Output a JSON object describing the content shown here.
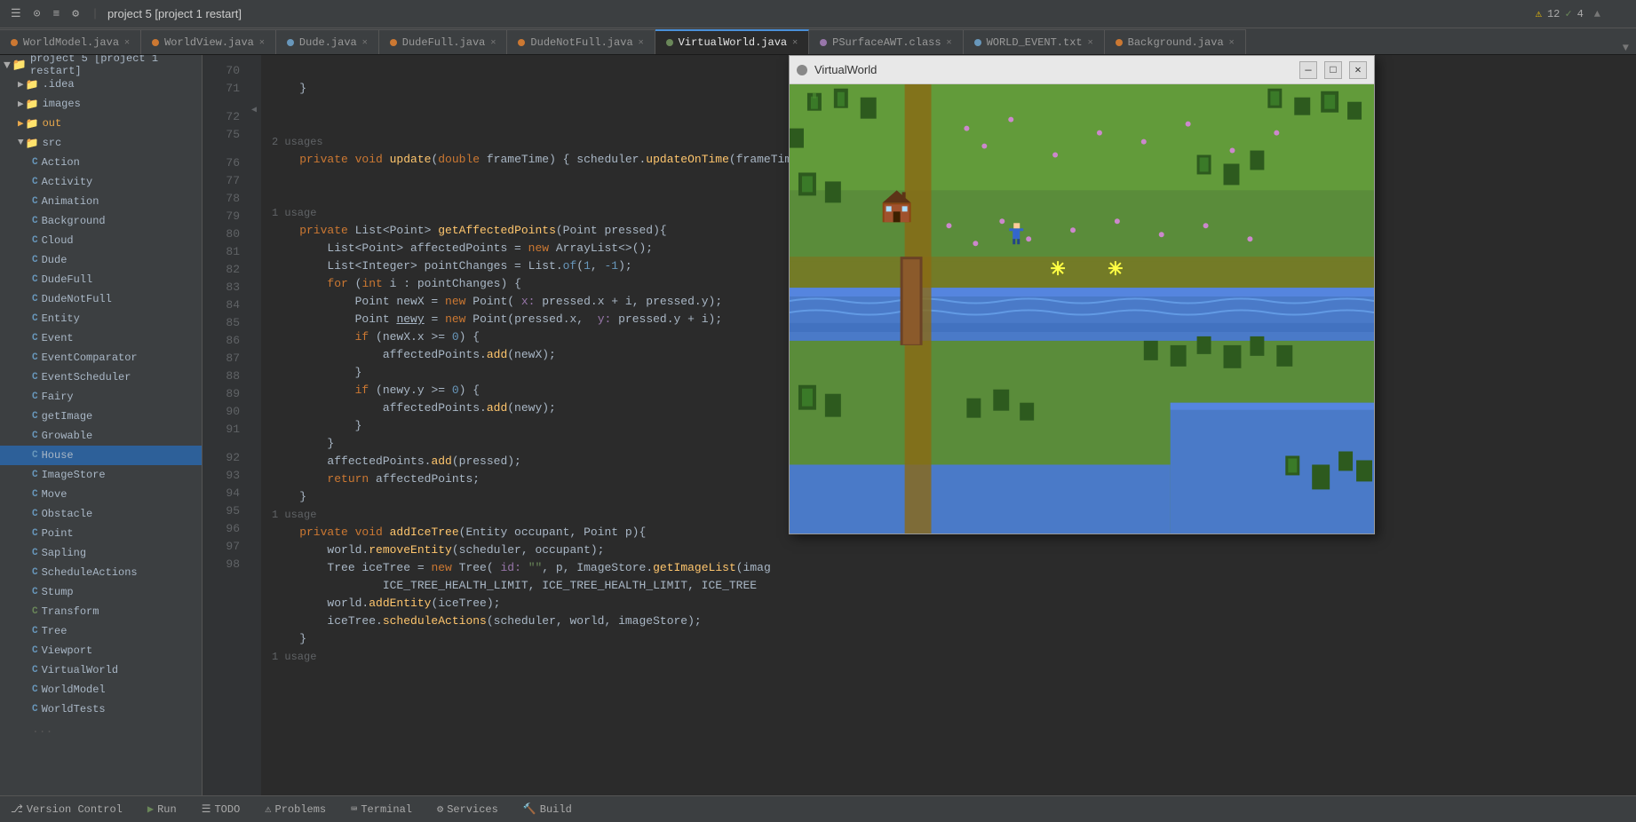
{
  "topbar": {
    "project_label": "project 5 [project 1 restart]",
    "icons": [
      "☰",
      "⊙",
      "≡",
      "⚙",
      "—",
      "□"
    ]
  },
  "tabs": [
    {
      "label": "WorldModel.java",
      "dot": "orange",
      "active": false,
      "closeable": true
    },
    {
      "label": "WorldView.java",
      "dot": "orange",
      "active": false,
      "closeable": true
    },
    {
      "label": "Dude.java",
      "dot": "blue",
      "active": false,
      "closeable": true
    },
    {
      "label": "DudeFull.java",
      "dot": "orange",
      "active": false,
      "closeable": true
    },
    {
      "label": "DudeNotFull.java",
      "dot": "orange",
      "active": false,
      "closeable": true
    },
    {
      "label": "VirtualWorld.java",
      "dot": "green",
      "active": true,
      "closeable": true
    },
    {
      "label": "PSurfaceAWT.class",
      "dot": "purple",
      "active": false,
      "closeable": true
    },
    {
      "label": "WORLD_EVENT.txt",
      "dot": "blue",
      "active": false,
      "closeable": true
    },
    {
      "label": "Background.java",
      "dot": "orange",
      "active": false,
      "closeable": true
    }
  ],
  "warnings": {
    "warn_count": "12",
    "check_count": "4"
  },
  "sidebar": {
    "project_root": "project 5 [project 1 restart]",
    "items": [
      {
        "name": ".idea",
        "type": "folder",
        "indent": 1,
        "expanded": false
      },
      {
        "name": "images",
        "type": "folder",
        "indent": 1,
        "expanded": false
      },
      {
        "name": "out",
        "type": "folder",
        "indent": 1,
        "expanded": false,
        "color": "orange"
      },
      {
        "name": "src",
        "type": "folder",
        "indent": 1,
        "expanded": true
      },
      {
        "name": "Action",
        "type": "class",
        "indent": 2,
        "color": "blue"
      },
      {
        "name": "Activity",
        "type": "class",
        "indent": 2,
        "color": "blue"
      },
      {
        "name": "Animation",
        "type": "class",
        "indent": 2,
        "color": "blue"
      },
      {
        "name": "Background",
        "type": "class",
        "indent": 2,
        "color": "blue"
      },
      {
        "name": "Cloud",
        "type": "class",
        "indent": 2,
        "color": "blue"
      },
      {
        "name": "Dude",
        "type": "class",
        "indent": 2,
        "color": "blue"
      },
      {
        "name": "DudeFull",
        "type": "class",
        "indent": 2,
        "color": "blue"
      },
      {
        "name": "DudeNotFull",
        "type": "class",
        "indent": 2,
        "color": "blue"
      },
      {
        "name": "Entity",
        "type": "class",
        "indent": 2,
        "color": "blue"
      },
      {
        "name": "Event",
        "type": "class",
        "indent": 2,
        "color": "blue"
      },
      {
        "name": "EventComparator",
        "type": "class",
        "indent": 2,
        "color": "blue"
      },
      {
        "name": "EventScheduler",
        "type": "class",
        "indent": 2,
        "color": "blue"
      },
      {
        "name": "Fairy",
        "type": "class",
        "indent": 2,
        "color": "blue"
      },
      {
        "name": "getImage",
        "type": "class",
        "indent": 2,
        "color": "blue"
      },
      {
        "name": "Growable",
        "type": "class",
        "indent": 2,
        "color": "blue"
      },
      {
        "name": "House",
        "type": "class",
        "indent": 2,
        "color": "blue",
        "selected": true
      },
      {
        "name": "ImageStore",
        "type": "class",
        "indent": 2,
        "color": "blue"
      },
      {
        "name": "Move",
        "type": "class",
        "indent": 2,
        "color": "blue"
      },
      {
        "name": "Obstacle",
        "type": "class",
        "indent": 2,
        "color": "blue"
      },
      {
        "name": "Point",
        "type": "class",
        "indent": 2,
        "color": "blue"
      },
      {
        "name": "Sapling",
        "type": "class",
        "indent": 2,
        "color": "blue"
      },
      {
        "name": "ScheduleActions",
        "type": "class",
        "indent": 2,
        "color": "blue"
      },
      {
        "name": "Stump",
        "type": "class",
        "indent": 2,
        "color": "blue"
      },
      {
        "name": "Transform",
        "type": "class",
        "indent": 2,
        "color": "blue"
      },
      {
        "name": "Tree",
        "type": "class",
        "indent": 2,
        "color": "blue"
      },
      {
        "name": "Viewport",
        "type": "class",
        "indent": 2,
        "color": "blue"
      },
      {
        "name": "VirtualWorld",
        "type": "class",
        "indent": 2,
        "color": "blue"
      },
      {
        "name": "WorldModel",
        "type": "class",
        "indent": 2,
        "color": "blue"
      },
      {
        "name": "WorldTests",
        "type": "class",
        "indent": 2,
        "color": "blue"
      }
    ]
  },
  "editor": {
    "lines": [
      {
        "num": "70",
        "content": "    }",
        "type": "plain"
      },
      {
        "num": "71",
        "content": "",
        "type": "plain"
      },
      {
        "num": "",
        "content": "2 usages",
        "type": "hint"
      },
      {
        "num": "72",
        "content": "    private void update(double frameTime) { scheduler.updateOnTime(frameTime); }",
        "type": "code"
      },
      {
        "num": "75",
        "content": "",
        "type": "plain"
      },
      {
        "num": "",
        "content": "1 usage",
        "type": "hint"
      },
      {
        "num": "76",
        "content": "    private List<Point> getAffectedPoints(Point pressed){",
        "type": "code"
      },
      {
        "num": "77",
        "content": "        List<Point> affectedPoints = new ArrayList<>();",
        "type": "code"
      },
      {
        "num": "78",
        "content": "        List<Integer> pointChanges = List.of(1, -1);",
        "type": "code"
      },
      {
        "num": "79",
        "content": "        for (int i : pointChanges) {",
        "type": "code"
      },
      {
        "num": "80",
        "content": "            Point newX = new Point( x: pressed.x + i, pressed.y);",
        "type": "code"
      },
      {
        "num": "81",
        "content": "            Point newy = new Point(pressed.x,  y: pressed.y + i);",
        "type": "code"
      },
      {
        "num": "82",
        "content": "            if (newX.x >= 0) {",
        "type": "code"
      },
      {
        "num": "83",
        "content": "                affectedPoints.add(newX);",
        "type": "code"
      },
      {
        "num": "84",
        "content": "            }",
        "type": "code"
      },
      {
        "num": "85",
        "content": "            if (newy.y >= 0) {",
        "type": "code"
      },
      {
        "num": "86",
        "content": "                affectedPoints.add(newy);",
        "type": "code"
      },
      {
        "num": "87",
        "content": "            }",
        "type": "code"
      },
      {
        "num": "88",
        "content": "        }",
        "type": "code"
      },
      {
        "num": "89",
        "content": "        affectedPoints.add(pressed);",
        "type": "code"
      },
      {
        "num": "90",
        "content": "        return affectedPoints;",
        "type": "code"
      },
      {
        "num": "91",
        "content": "    }",
        "type": "code"
      },
      {
        "num": "",
        "content": "1 usage",
        "type": "hint"
      },
      {
        "num": "92",
        "content": "    private void addIceTree(Entity occupant, Point p){",
        "type": "code"
      },
      {
        "num": "93",
        "content": "        world.removeEntity(scheduler, occupant);",
        "type": "code"
      },
      {
        "num": "94",
        "content": "        Tree iceTree = new Tree( id: \"\", p, ImageStore.getImageList(imag",
        "type": "code"
      },
      {
        "num": "95",
        "content": "                ICE_TREE_HEALTH_LIMIT, ICE_TREE_HEALTH_LIMIT, ICE_TREE",
        "type": "code"
      },
      {
        "num": "96",
        "content": "        world.addEntity(iceTree);",
        "type": "code"
      },
      {
        "num": "97",
        "content": "        iceTree.scheduleActions(scheduler, world, imageStore);",
        "type": "code"
      },
      {
        "num": "98",
        "content": "    }",
        "type": "code"
      },
      {
        "num": "",
        "content": "1 usage",
        "type": "hint"
      }
    ]
  },
  "virtualworld": {
    "title": "VirtualWorld",
    "close_btn": "✕",
    "minimize_btn": "—",
    "maximize_btn": "□"
  },
  "bottombar": {
    "items": [
      {
        "label": "Version Control",
        "icon": "⎇"
      },
      {
        "label": "▶ Run",
        "icon": ""
      },
      {
        "label": "☰ TODO",
        "icon": ""
      },
      {
        "label": "⚠ Problems",
        "icon": ""
      },
      {
        "label": "Terminal",
        "icon": ""
      },
      {
        "label": "Services",
        "icon": ""
      },
      {
        "label": "Build",
        "icon": ""
      }
    ]
  }
}
